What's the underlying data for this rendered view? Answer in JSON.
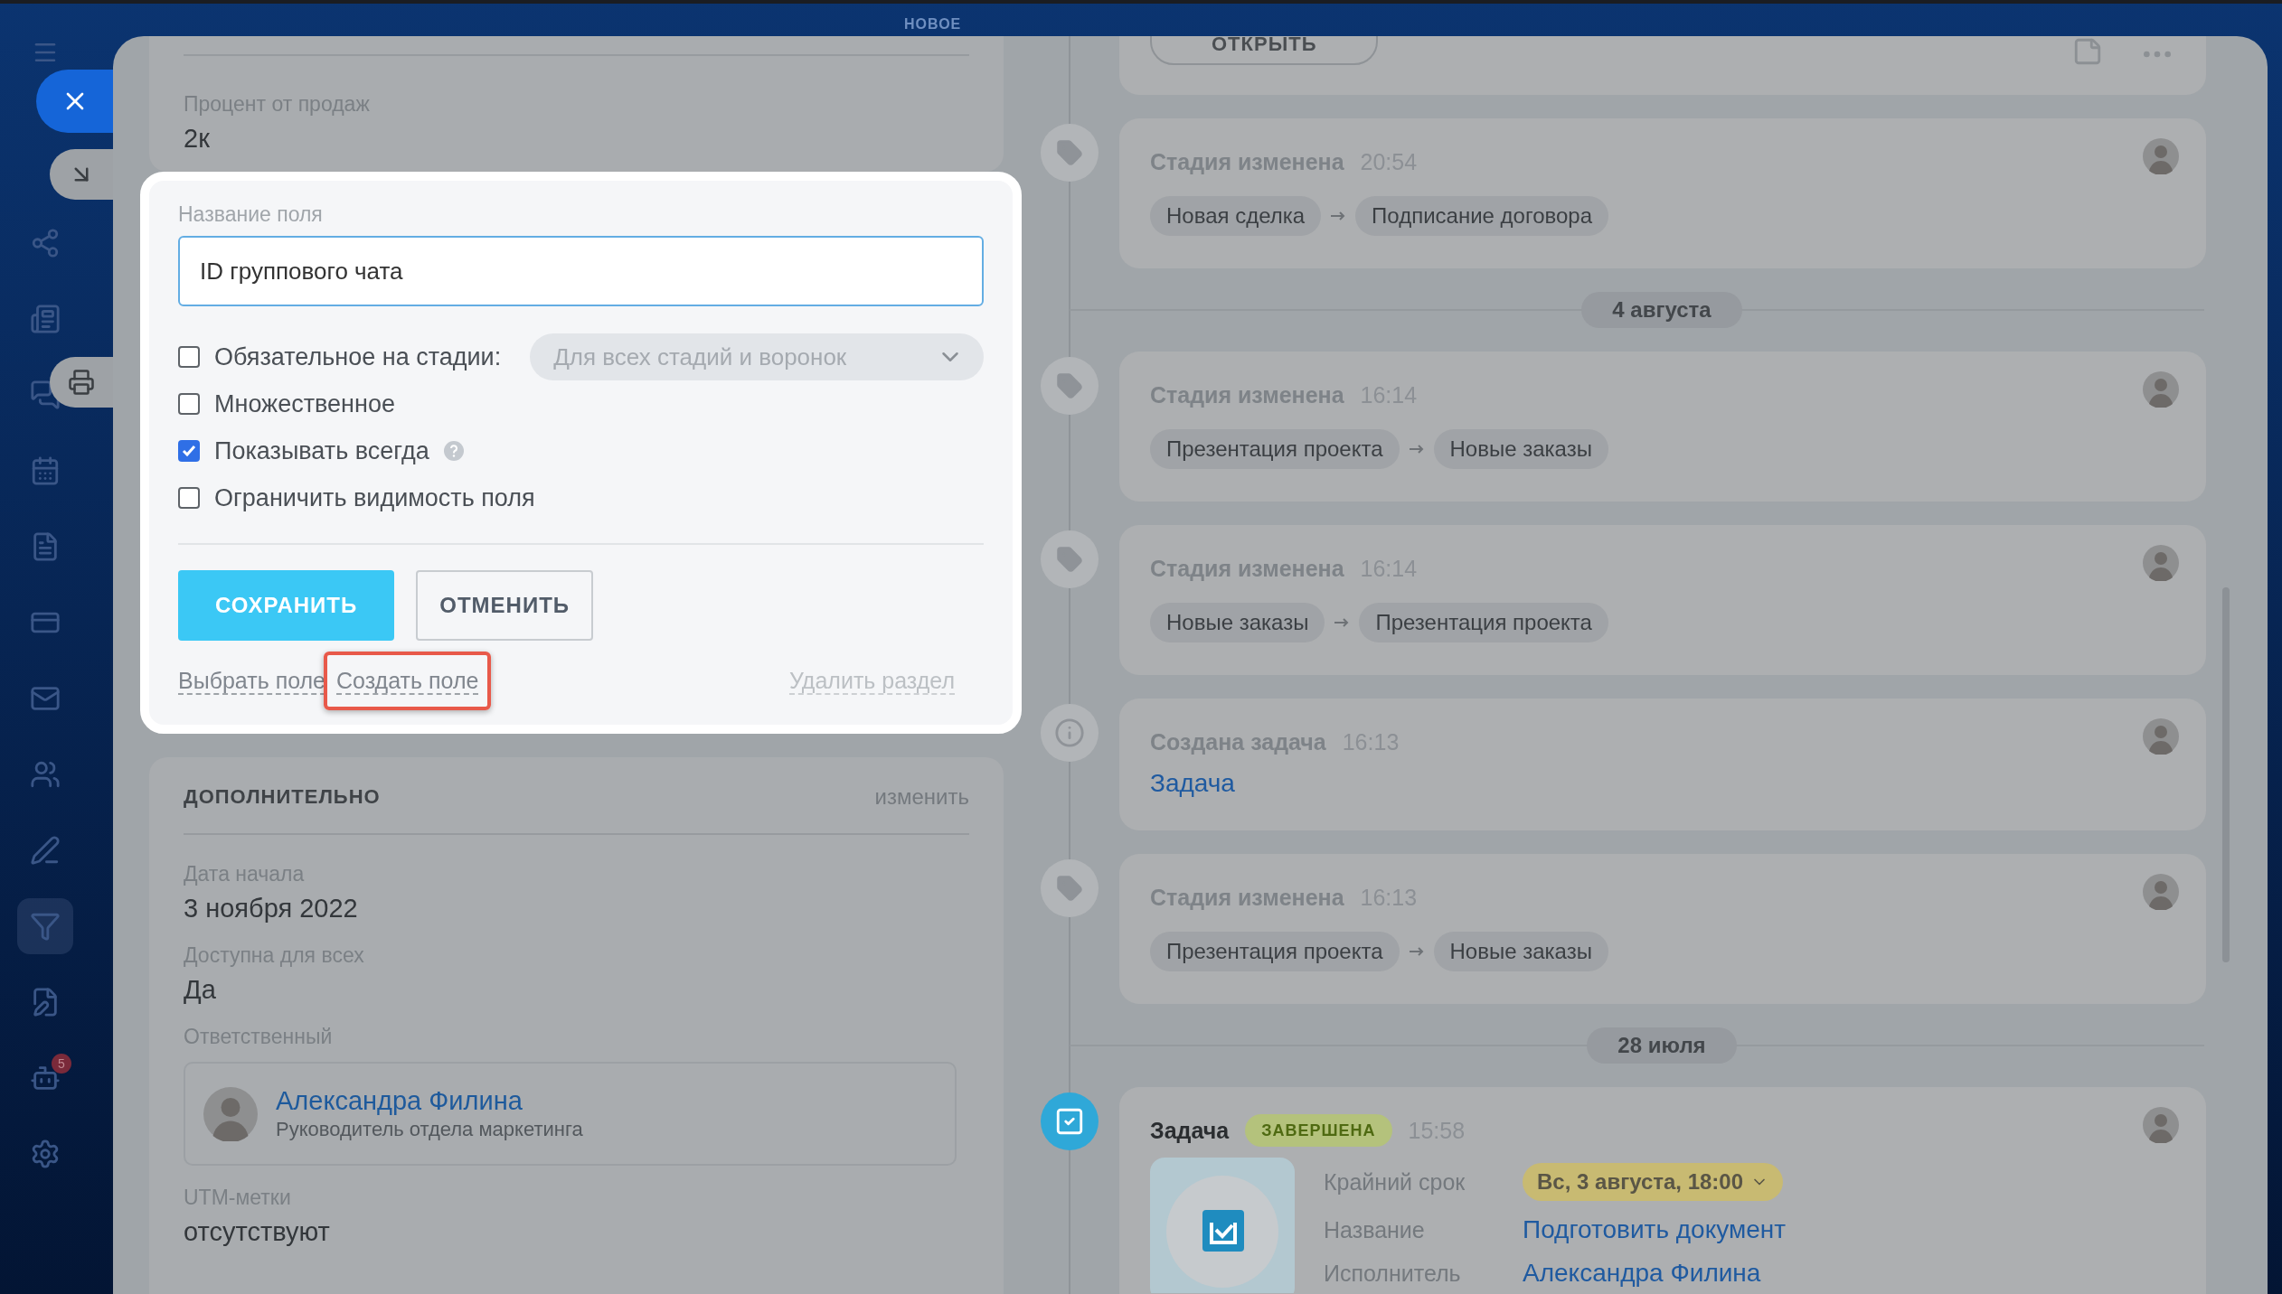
{
  "top_label": "НОВОЕ",
  "sidebar": {
    "badge": "5"
  },
  "left_card": {
    "fields": [
      {
        "label": "Процент от продаж",
        "value": "2к"
      }
    ]
  },
  "field_editor": {
    "label": "Название поля",
    "value": "ID группового чата",
    "options": [
      {
        "label": "Обязательное на стадии:",
        "checked": false,
        "select": "Для всех стадий и воронок",
        "help": false
      },
      {
        "label": "Множественное",
        "checked": false,
        "help": false
      },
      {
        "label": "Показывать всегда",
        "checked": true,
        "help": true
      },
      {
        "label": "Ограничить видимость поля",
        "checked": false,
        "help": false
      }
    ],
    "buttons": [
      {
        "label": "СОХРАНИТЬ",
        "kind": "primary"
      },
      {
        "label": "ОТМЕНИТЬ",
        "kind": "secondary"
      }
    ],
    "links": [
      {
        "label": "Выбрать поле",
        "highlighted": false,
        "disabled": false
      },
      {
        "label": "Создать поле",
        "highlighted": true,
        "disabled": false
      },
      {
        "label": "Удалить раздел",
        "highlighted": false,
        "disabled": true
      }
    ]
  },
  "additional": {
    "title": "ДОПОЛНИТЕЛЬНО",
    "action": "изменить",
    "fields": [
      {
        "kind": "text",
        "label": "Дата начала",
        "value": "3 ноября 2022"
      },
      {
        "kind": "text",
        "label": "Доступна для всех",
        "value": "Да"
      },
      {
        "kind": "person",
        "label": "Ответственный",
        "name": "Александра Филина",
        "position": "Руководитель отдела маркетинга"
      },
      {
        "kind": "text",
        "label": "UTM-метки",
        "value": "отсутствуют"
      }
    ]
  },
  "timeline": [
    {
      "kind": "open",
      "button": "ОТКРЫТЬ"
    },
    {
      "kind": "stage",
      "title": "Стадия изменена",
      "time": "20:54",
      "from": "Новая сделка",
      "to": "Подписание договора"
    },
    {
      "kind": "date",
      "label": "4 августа"
    },
    {
      "kind": "stage",
      "title": "Стадия изменена",
      "time": "16:14",
      "from": "Презентация проекта",
      "to": "Новые заказы"
    },
    {
      "kind": "stage",
      "title": "Стадия изменена",
      "time": "16:14",
      "from": "Новые заказы",
      "to": "Презентация проекта"
    },
    {
      "kind": "task_created",
      "title": "Создана задача",
      "time": "16:13",
      "link": "Задача"
    },
    {
      "kind": "stage",
      "title": "Стадия изменена",
      "time": "16:13",
      "from": "Презентация проекта",
      "to": "Новые заказы"
    },
    {
      "kind": "date",
      "label": "28 июля"
    },
    {
      "kind": "task",
      "title": "Задача",
      "status": "ЗАВЕРШЕНА",
      "time": "15:58",
      "rows": [
        {
          "kind": "deadline",
          "label": "Крайний срок",
          "value": "Вс, 3 августа, 18:00"
        },
        {
          "kind": "link",
          "label": "Название",
          "value": "Подготовить документ"
        },
        {
          "kind": "link",
          "label": "Исполнитель",
          "value": "Александра Филина"
        }
      ]
    }
  ]
}
